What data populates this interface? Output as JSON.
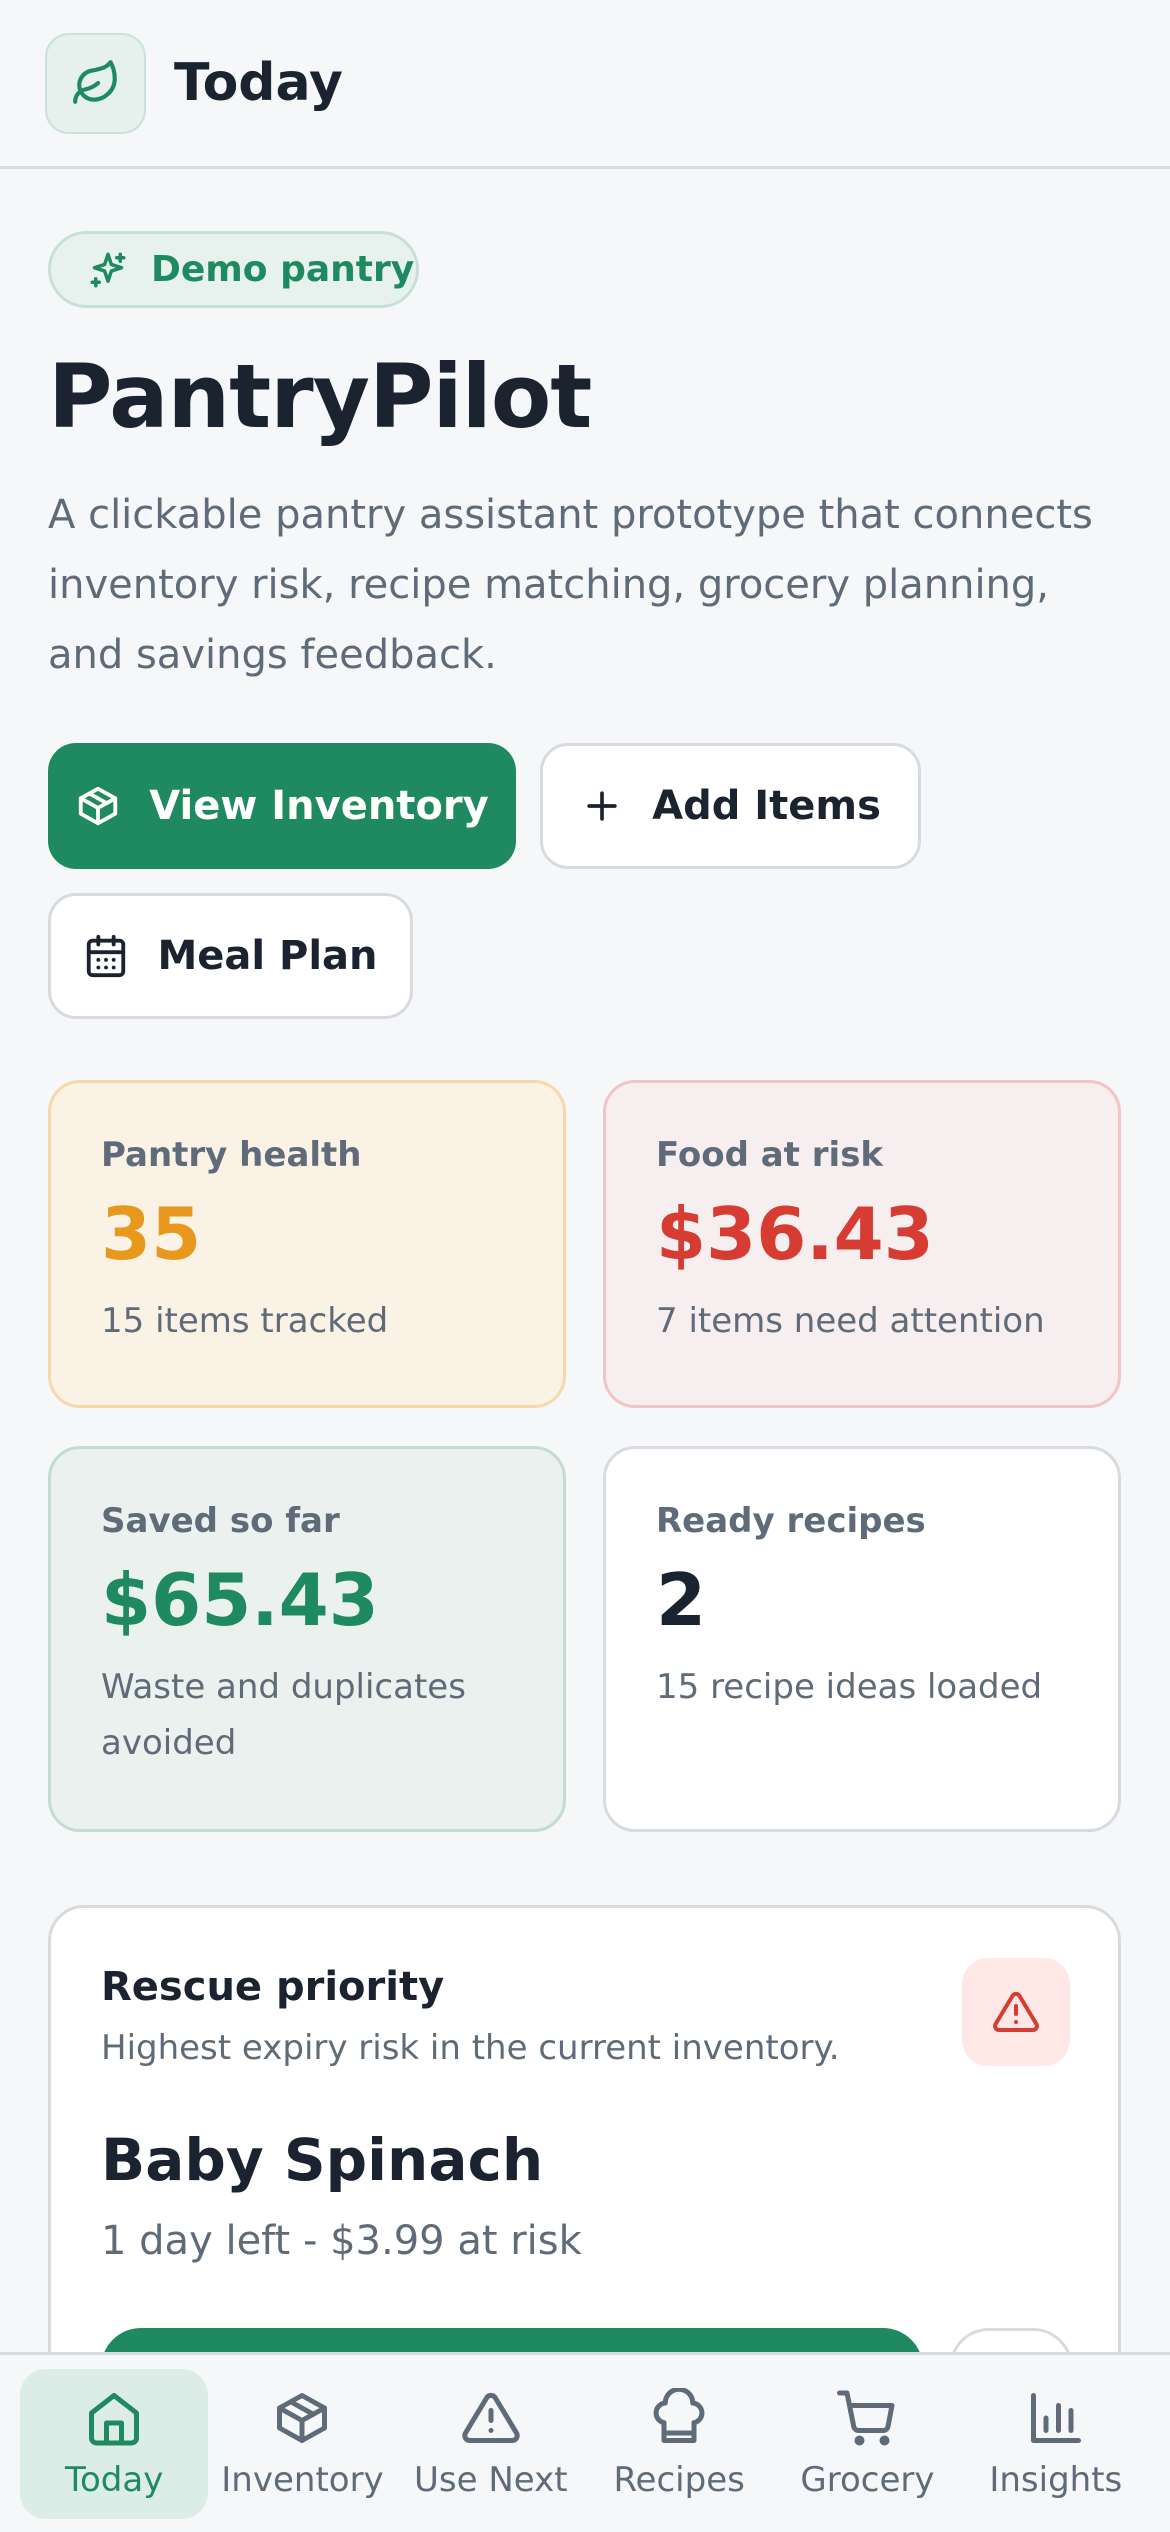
{
  "header": {
    "title": "Today",
    "logo_icon": "leaf-icon"
  },
  "badge": {
    "label": "Demo pantry",
    "icon": "sparkle-icon"
  },
  "hero": {
    "app_name": "PantryPilot",
    "tagline": "A clickable pantry assistant prototype that connects inventory risk, recipe matching, grocery planning, and savings feedback."
  },
  "actions": {
    "view_inventory": "View Inventory",
    "add_items": "Add Items",
    "meal_plan": "Meal Plan"
  },
  "stats": {
    "health": {
      "label": "Pantry health",
      "value": "35",
      "sub": "15 items tracked"
    },
    "risk": {
      "label": "Food at risk",
      "value": "$36.43",
      "sub": "7 items need attention"
    },
    "saved": {
      "label": "Saved so far",
      "value": "$65.43",
      "sub": "Waste and duplicates avoided"
    },
    "ready": {
      "label": "Ready recipes",
      "value": "2",
      "sub": "15 recipe ideas loaded"
    }
  },
  "rescue": {
    "title": "Rescue priority",
    "subtitle": "Highest expiry risk in the current inventory.",
    "item_name": "Baby Spinach",
    "item_meta": "1 day left - $3.99 at risk"
  },
  "nav": [
    {
      "label": "Today",
      "icon": "home-icon",
      "active": true
    },
    {
      "label": "Inventory",
      "icon": "box-icon",
      "active": false
    },
    {
      "label": "Use Next",
      "icon": "warning-icon",
      "active": false
    },
    {
      "label": "Recipes",
      "icon": "chef-hat-icon",
      "active": false
    },
    {
      "label": "Grocery",
      "icon": "cart-icon",
      "active": false
    },
    {
      "label": "Insights",
      "icon": "bar-chart-icon",
      "active": false
    }
  ],
  "colors": {
    "brand": "#1f8a62",
    "warning": "#e8991d",
    "danger": "#d63c32",
    "text": "#1b2230",
    "muted": "#5f6b78"
  }
}
